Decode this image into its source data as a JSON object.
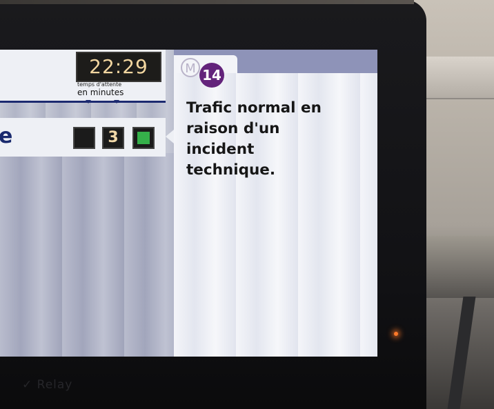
{
  "header": {
    "clock": "22:29",
    "wait_label_small": "temps d'attente",
    "wait_label_big": "en minutes"
  },
  "destination_row": {
    "name_fragment": "e",
    "slot_value": "3"
  },
  "info_panel": {
    "network_mark": "M",
    "line_number": "14",
    "line_color": "#63237B",
    "message": "Trafic normal en\nraison d'un\nincident\ntechnique."
  },
  "device": {
    "brand_watermark": "✓ Relay",
    "status_led_color": "#FF7A2A"
  },
  "colors": {
    "accent_navy": "#1C2A70",
    "departure_green": "#35B04A",
    "digit_amber": "#F2D6A0"
  }
}
